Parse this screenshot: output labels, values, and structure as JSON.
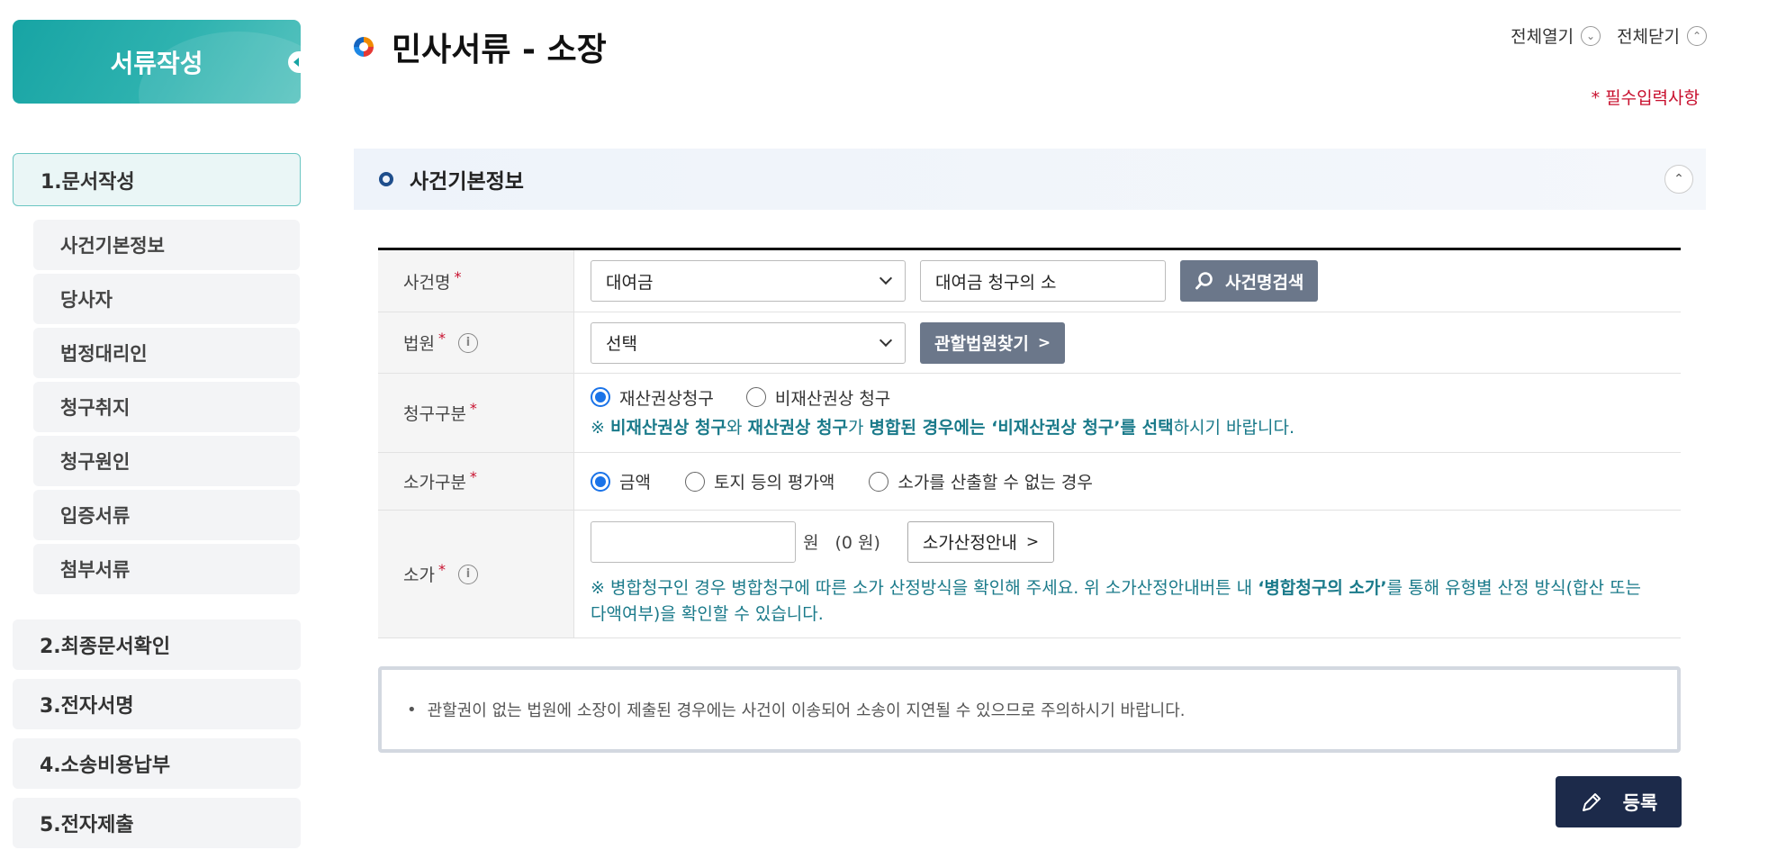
{
  "sidebar": {
    "header": "서류작성",
    "steps": [
      {
        "label": "1.문서작성"
      },
      {
        "label": "2.최종문서확인"
      },
      {
        "label": "3.전자서명"
      },
      {
        "label": "4.소송비용납부"
      },
      {
        "label": "5.전자제출"
      }
    ],
    "sub_items": [
      {
        "label": "사건기본정보"
      },
      {
        "label": "당사자"
      },
      {
        "label": "법정대리인"
      },
      {
        "label": "청구취지"
      },
      {
        "label": "청구원인"
      },
      {
        "label": "입증서류"
      },
      {
        "label": "첨부서류"
      }
    ]
  },
  "header": {
    "title": "민사서류 - 소장",
    "expand_all": "전체열기",
    "collapse_all": "전체닫기",
    "required_note": "* 필수입력사항"
  },
  "section": {
    "title": "사건기본정보"
  },
  "form": {
    "case_name": {
      "label": "사건명",
      "required": "*",
      "select_value": "대여금",
      "input_value": "대여금 청구의 소",
      "search_button": "사건명검색"
    },
    "court": {
      "label": "법원",
      "required": "*",
      "info": "i",
      "select_value": "선택",
      "find_button": "관할법원찾기",
      "find_arrow": ">"
    },
    "claim_type": {
      "label": "청구구분",
      "required": "*",
      "options": [
        "재산권상청구",
        "비재산권상 청구"
      ],
      "selected": 0,
      "notice_prefix": "※ ",
      "notice_bold1": "비재산권상 청구",
      "notice_mid1": "와 ",
      "notice_bold2": "재산권상 청구",
      "notice_mid2": "가 ",
      "notice_bold3": "병합된 경우에는 ‘비재산권상 청구’를 선택",
      "notice_end": "하시기 바랍니다."
    },
    "value_type": {
      "label": "소가구분",
      "required": "*",
      "options": [
        "금액",
        "토지 등의 평가액",
        "소가를 산출할 수 없는 경우"
      ],
      "selected": 0
    },
    "value": {
      "label": "소가",
      "required": "*",
      "info": "i",
      "input_value": "",
      "unit": "원",
      "amount_text": "(0 원)",
      "guide_button": "소가산정안내",
      "guide_arrow": ">",
      "notice_a": "※ 병합청구인 경우 병합청구에 따른 소가 산정방식을 확인해 주세요.  위 소가산정안내버튼 내 ",
      "notice_bold": "‘병합청구의 소가’",
      "notice_b": "를 통해 유형별 산정 방식(합산 또는 다액여부)을 확인할 수 있습니다."
    }
  },
  "info_box": {
    "bullet": "•",
    "text": "관할권이 없는 법원에 소장이 제출된 경우에는 사건이 이송되어 소송이 지연될 수 있으므로 주의하시기 바랍니다."
  },
  "register_button": "등록",
  "colors": {
    "teal": "#17a4a4",
    "navy": "#1c2a4a",
    "required_red": "#c8102e",
    "notice_teal": "#1a7a8a",
    "button_gray": "#6b778a",
    "radio_blue": "#1a73e8"
  }
}
